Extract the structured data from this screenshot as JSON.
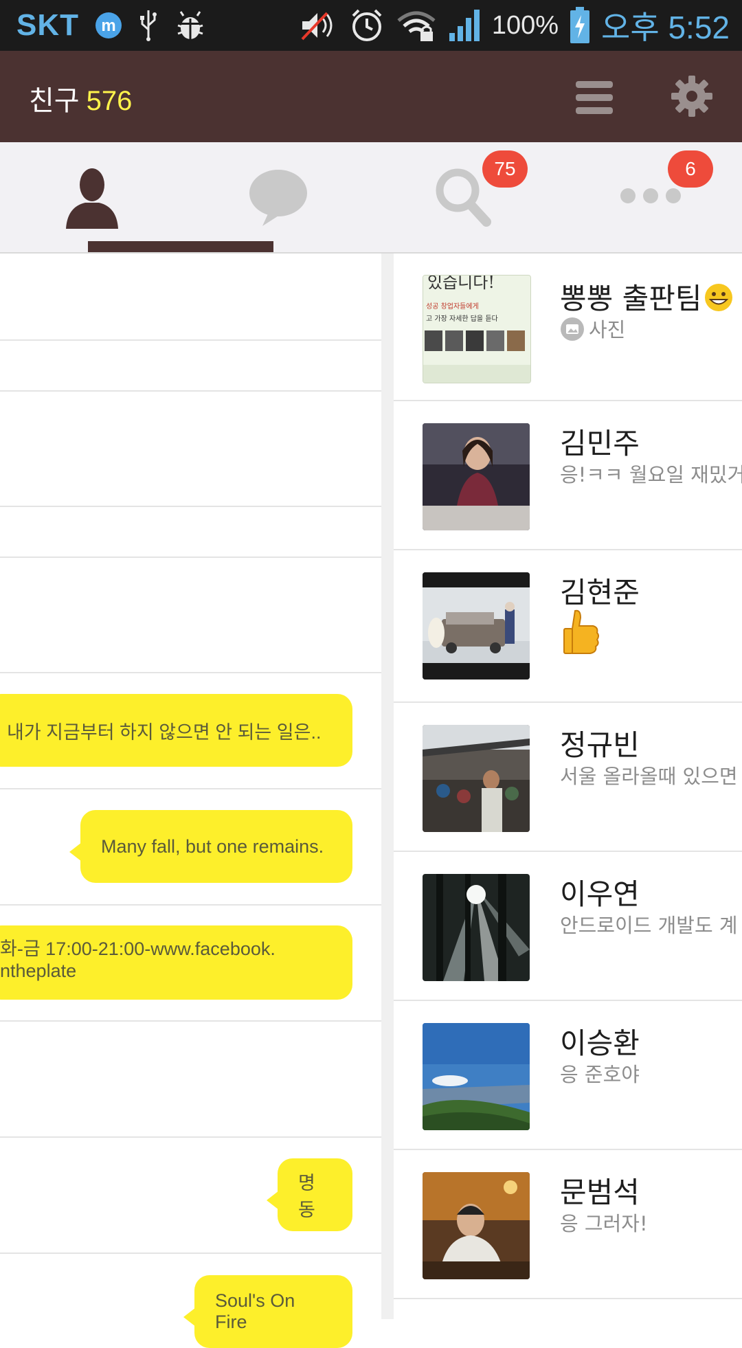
{
  "status_bar": {
    "carrier": "SKT",
    "battery": "100%",
    "time": "오후 5:52",
    "icons": [
      "messenger-icon",
      "usb-icon",
      "debug-icon",
      "mute-icon",
      "alarm-icon",
      "wifi-lock-icon",
      "signal-icon",
      "battery-charging-icon"
    ]
  },
  "header": {
    "title": "친구",
    "count": "576",
    "menu_icon": "hamburger-icon",
    "settings_icon": "gear-icon"
  },
  "tabs": [
    {
      "name": "friends",
      "icon": "person-icon",
      "active": true
    },
    {
      "name": "chats",
      "icon": "speech-bubble-icon"
    },
    {
      "name": "find",
      "icon": "search-icon",
      "badge": "75"
    },
    {
      "name": "more",
      "icon": "more-dots-icon",
      "badge": "6"
    }
  ],
  "chat_messages": [
    "내가 지금부터 하지 않으면 안 되는 일은..",
    "Many fall, but one remains.",
    "화-금 17:00-21:00-www.facebook.",
    "ntheplate",
    "명동",
    "Soul's On Fire"
  ],
  "friends": [
    {
      "name": "뽕뽕 출판팀",
      "status": "사진",
      "status_icon": "photo-icon",
      "name_icon": "grin-emoji-icon",
      "avatar_text": [
        "있습니다!",
        "성공 창업자들에게",
        "고 가장 자세한 답을 듣다"
      ]
    },
    {
      "name": "김민주",
      "status": "응!ㅋㅋ 월요일 재밌거"
    },
    {
      "name": "김현준",
      "status": "",
      "status_icon": "thumbs-up-emoji-icon"
    },
    {
      "name": "정규빈",
      "status": "서울 올라올때 있으면"
    },
    {
      "name": "이우연",
      "status": "안드로이드 개발도 계"
    },
    {
      "name": "이승환",
      "status": "응 준호야"
    },
    {
      "name": "문범석",
      "status": "응 그러자!"
    }
  ],
  "colors": {
    "header_bg": "#4b3231",
    "count_accent": "#fff34b",
    "bubble": "#fdef2b",
    "badge": "#ee4b3b",
    "status_text": "#62b3e6"
  }
}
